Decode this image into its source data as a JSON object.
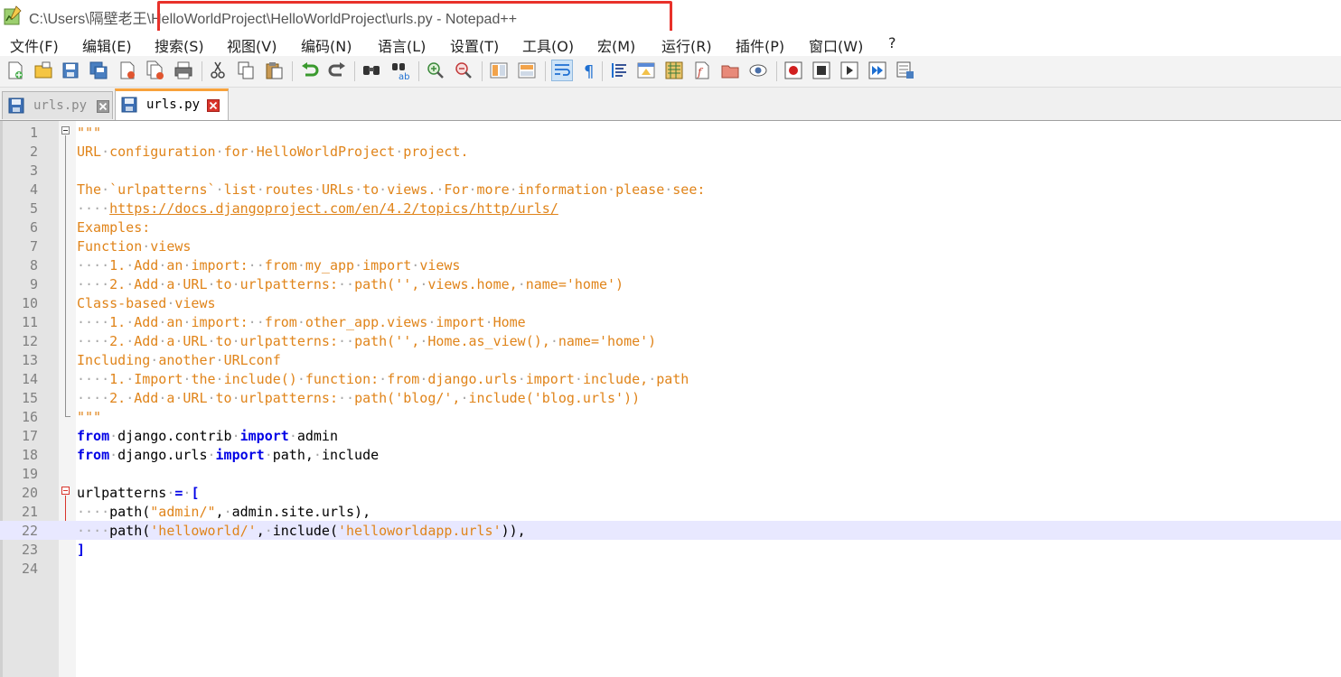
{
  "window": {
    "title": "C:\\Users\\隔壁老王\\HelloWorldProject\\HelloWorldProject\\urls.py - Notepad++"
  },
  "menu": [
    "文件(F)",
    "编辑(E)",
    "搜索(S)",
    "视图(V)",
    "编码(N)",
    "语言(L)",
    "设置(T)",
    "工具(O)",
    "宏(M)",
    "运行(R)",
    "插件(P)",
    "窗口(W)",
    "?"
  ],
  "toolbar": {
    "icons": [
      "new-file-icon",
      "open-file-icon",
      "save-icon",
      "save-all-icon",
      "close-icon",
      "close-all-icon",
      "print-icon",
      "cut-icon",
      "copy-icon",
      "paste-icon",
      "undo-icon",
      "redo-icon",
      "find-icon",
      "replace-icon",
      "zoom-in-icon",
      "zoom-out-icon",
      "sync-vertical-icon",
      "sync-horizontal-icon",
      "word-wrap-icon",
      "show-all-chars-icon",
      "indent-guide-icon",
      "user-language-icon",
      "document-map-icon",
      "function-list-icon",
      "folder-workspace-icon",
      "monitoring-icon",
      "record-macro-icon",
      "stop-macro-icon",
      "play-macro-icon",
      "run-macro-multiple-icon",
      "save-macro-icon"
    ]
  },
  "tabs": [
    {
      "label": "urls.py",
      "active": false
    },
    {
      "label": "urls.py",
      "active": true
    }
  ],
  "editor": {
    "current_line": 22,
    "lines": [
      {
        "n": "1",
        "text": "\"\"\""
      },
      {
        "n": "2",
        "text": "URL·configuration·for·HelloWorldProject·project."
      },
      {
        "n": "3",
        "text": ""
      },
      {
        "n": "4",
        "text": "The·`urlpatterns`·list·routes·URLs·to·views.·For·more·information·please·see:"
      },
      {
        "n": "5",
        "text": "····https://docs.djangoproject.com/en/4.2/topics/http/urls/"
      },
      {
        "n": "6",
        "text": "Examples:"
      },
      {
        "n": "7",
        "text": "Function·views"
      },
      {
        "n": "8",
        "text": "····1.·Add·an·import:··from·my_app·import·views"
      },
      {
        "n": "9",
        "text": "····2.·Add·a·URL·to·urlpatterns:··path('',·views.home,·name='home')"
      },
      {
        "n": "10",
        "text": "Class-based·views"
      },
      {
        "n": "11",
        "text": "····1.·Add·an·import:··from·other_app.views·import·Home"
      },
      {
        "n": "12",
        "text": "····2.·Add·a·URL·to·urlpatterns:··path('',·Home.as_view(),·name='home')"
      },
      {
        "n": "13",
        "text": "Including·another·URLconf"
      },
      {
        "n": "14",
        "text": "····1.·Import·the·include()·function:·from·django.urls·import·include,·path"
      },
      {
        "n": "15",
        "text": "····2.·Add·a·URL·to·urlpatterns:··path('blog/',·include('blog.urls'))"
      },
      {
        "n": "16",
        "text": "\"\"\""
      },
      {
        "n": "17",
        "text": "from·django.contrib·import·admin"
      },
      {
        "n": "18",
        "text": "from·django.urls·import·path,·include"
      },
      {
        "n": "19",
        "text": ""
      },
      {
        "n": "20",
        "text": "urlpatterns·=·["
      },
      {
        "n": "21",
        "text": "····path(\"admin/\",·admin.site.urls),"
      },
      {
        "n": "22",
        "text": "····path('helloworld/',·include('helloworldapp.urls')),"
      },
      {
        "n": "23",
        "text": "]"
      },
      {
        "n": "24",
        "text": ""
      }
    ]
  },
  "colors": {
    "highlight_box": "#e8312a",
    "string": "#e0841a",
    "keyword": "#0000e6",
    "current_line": "#e8e8ff",
    "active_tab_accent": "#f8a23b"
  }
}
